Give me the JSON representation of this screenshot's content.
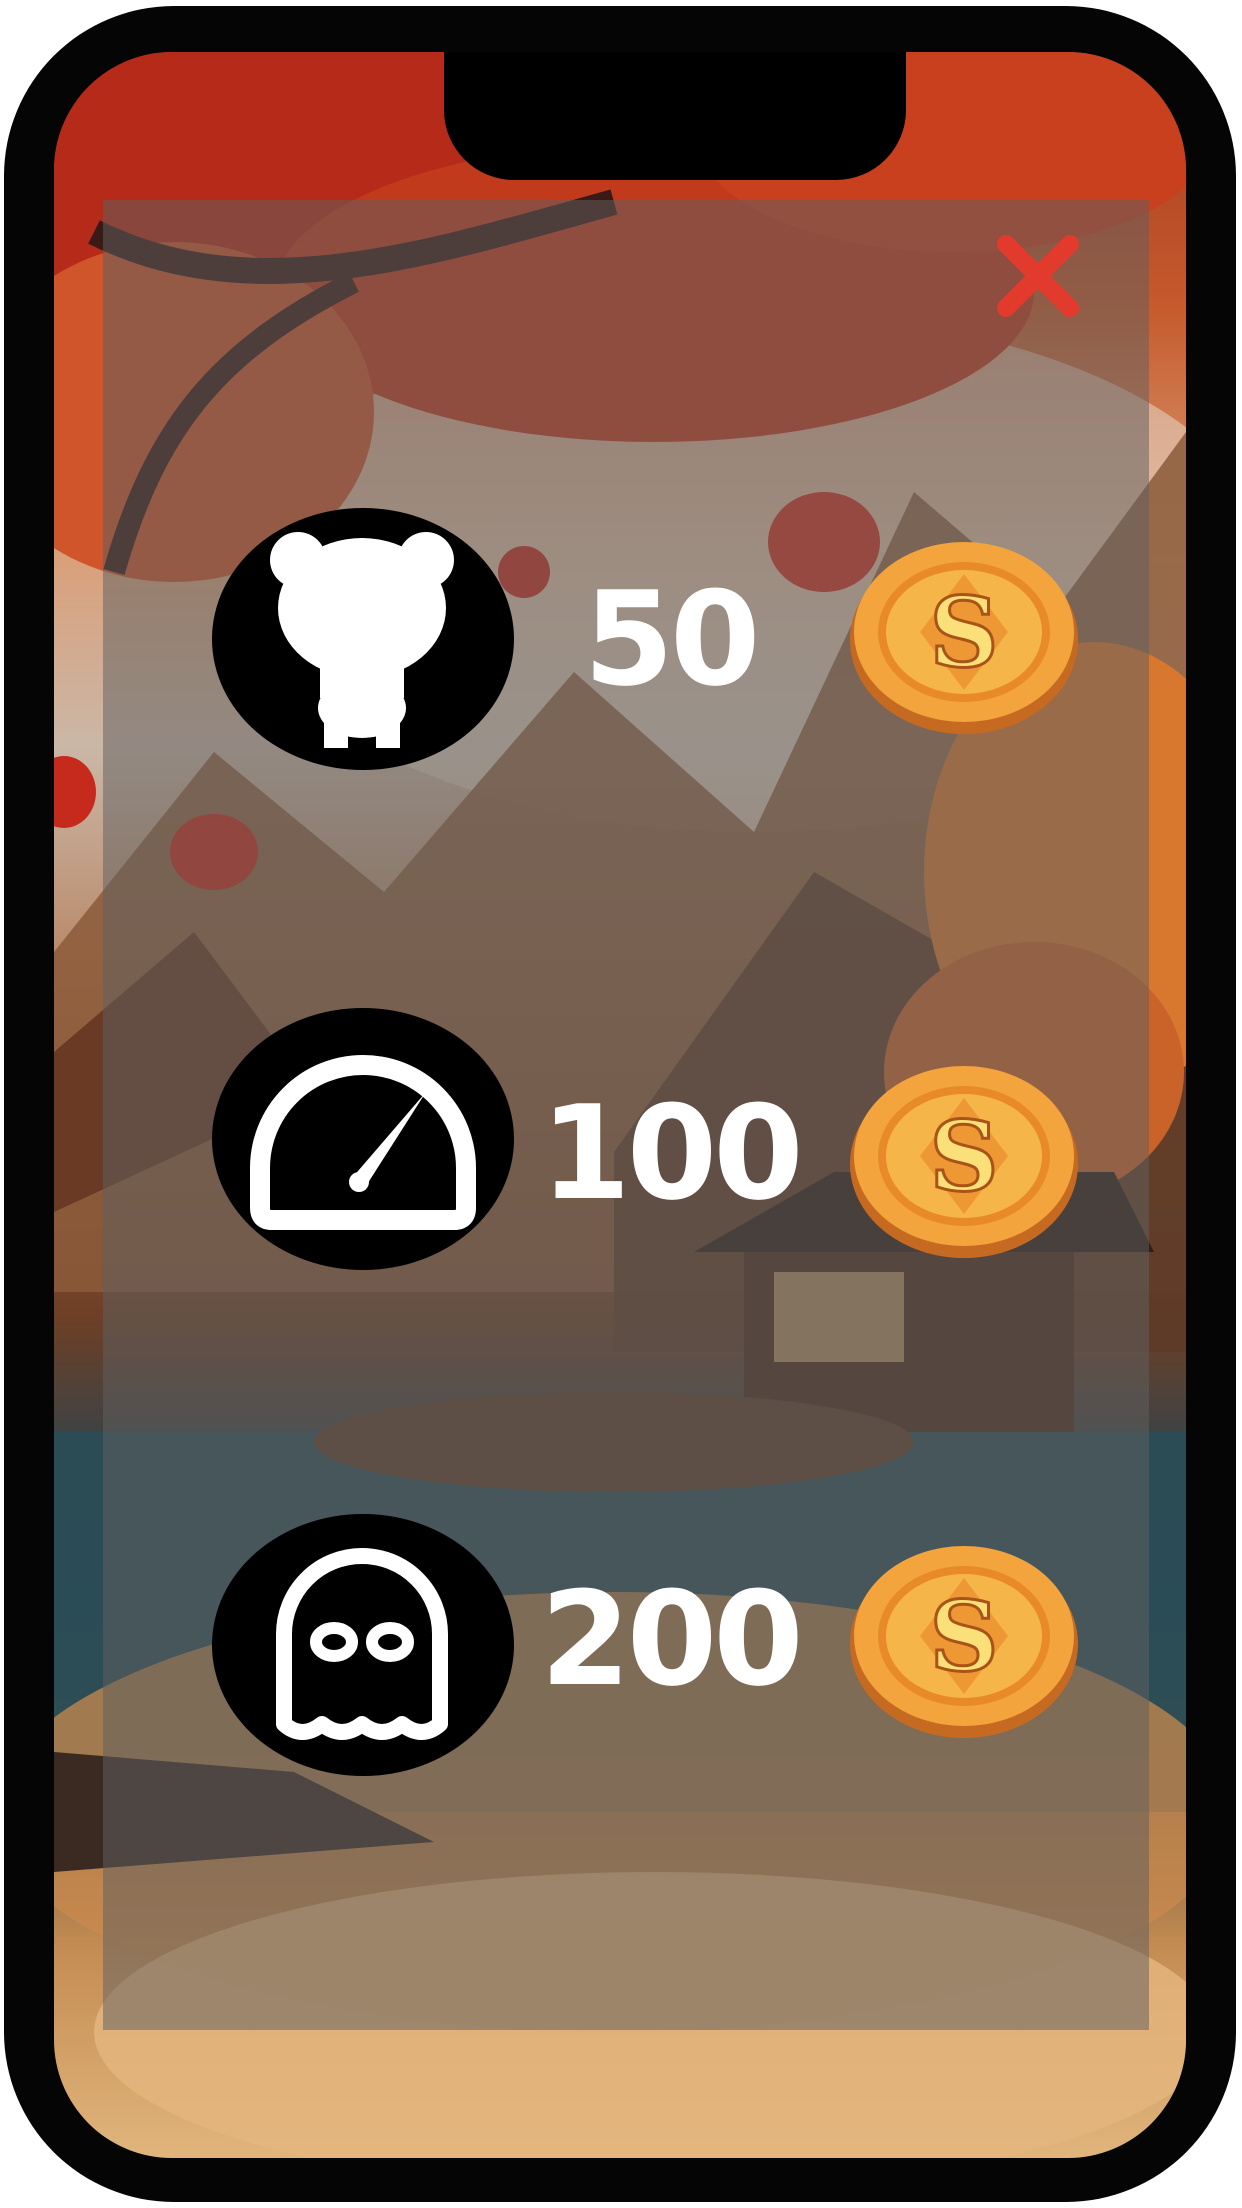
{
  "shop": {
    "items": [
      {
        "icon": "bear-character-icon",
        "price": "50"
      },
      {
        "icon": "speedometer-icon",
        "price": "100"
      },
      {
        "icon": "ghost-icon",
        "price": "200"
      }
    ],
    "currency_icon": "gold-coin-icon"
  },
  "colors": {
    "close": "#e23a2c",
    "panel": "#5f5f5f",
    "price_text": "#ffffff",
    "coin_gold": "#f3a43c"
  }
}
